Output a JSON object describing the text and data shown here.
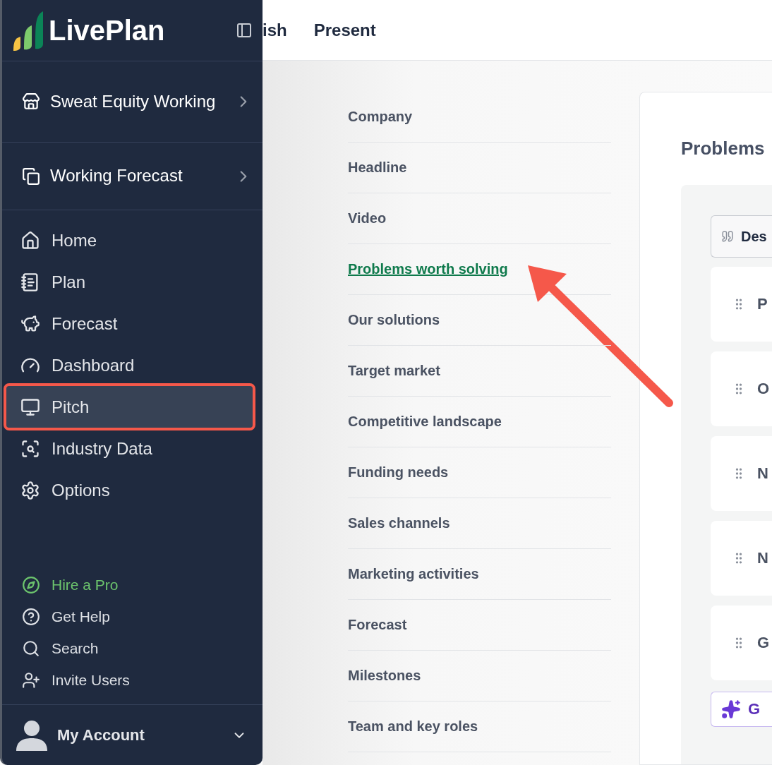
{
  "sidebar": {
    "logo": "LivePlan",
    "workspaces": [
      {
        "label": "Sweat Equity Working"
      },
      {
        "label": "Working Forecast"
      }
    ],
    "nav": [
      {
        "label": "Home",
        "selected": false,
        "highlighted": false
      },
      {
        "label": "Plan",
        "selected": false,
        "highlighted": false
      },
      {
        "label": "Forecast",
        "selected": false,
        "highlighted": false
      },
      {
        "label": "Dashboard",
        "selected": false,
        "highlighted": false
      },
      {
        "label": "Pitch",
        "selected": true,
        "highlighted": true
      },
      {
        "label": "Industry Data",
        "selected": false,
        "highlighted": false
      },
      {
        "label": "Options",
        "selected": false,
        "highlighted": false
      }
    ],
    "links": [
      {
        "label": "Hire a Pro",
        "kind": "promo"
      },
      {
        "label": "Get Help",
        "kind": "link"
      },
      {
        "label": "Search",
        "kind": "link"
      },
      {
        "label": "Invite Users",
        "kind": "link"
      }
    ],
    "account": "My Account"
  },
  "header_tabs": [
    {
      "label": "ish"
    },
    {
      "label": "Present"
    }
  ],
  "sections": [
    {
      "label": "Company",
      "selected": false,
      "arrow_to": false
    },
    {
      "label": "Headline",
      "selected": false,
      "arrow_to": false
    },
    {
      "label": "Video",
      "selected": false,
      "arrow_to": false
    },
    {
      "label": "Problems worth solving",
      "selected": true,
      "arrow_to": true
    },
    {
      "label": "Our solutions",
      "selected": false,
      "arrow_to": false
    },
    {
      "label": "Target market",
      "selected": false,
      "arrow_to": false
    },
    {
      "label": "Competitive landscape",
      "selected": false,
      "arrow_to": false
    },
    {
      "label": "Funding needs",
      "selected": false,
      "arrow_to": false
    },
    {
      "label": "Sales channels",
      "selected": false,
      "arrow_to": false
    },
    {
      "label": "Marketing activities",
      "selected": false,
      "arrow_to": false
    },
    {
      "label": "Forecast",
      "selected": false,
      "arrow_to": false
    },
    {
      "label": "Milestones",
      "selected": false,
      "arrow_to": false
    },
    {
      "label": "Team and key roles",
      "selected": false,
      "arrow_to": false
    }
  ],
  "editor": {
    "title": "Problems",
    "tab": "Des",
    "items": [
      "P",
      "O",
      "N",
      "N",
      "G"
    ],
    "generate_button": "G"
  }
}
